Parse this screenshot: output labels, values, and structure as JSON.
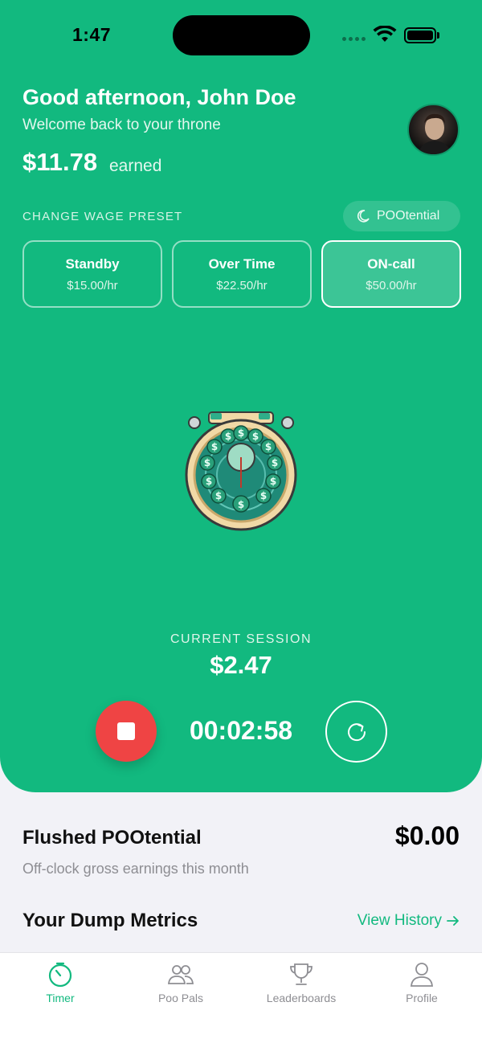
{
  "status": {
    "time": "1:47"
  },
  "header": {
    "greeting": "Good afternoon, John Doe",
    "welcome": "Welcome back to your throne",
    "earned_amount": "$11.78",
    "earned_label": "earned"
  },
  "wage": {
    "section_label": "CHANGE WAGE PRESET",
    "pootential_label": "POOtential",
    "presets": [
      {
        "name": "Standby",
        "rate": "$15.00/hr",
        "active": false
      },
      {
        "name": "Over Time",
        "rate": "$22.50/hr",
        "active": false
      },
      {
        "name": "ON-call",
        "rate": "$50.00/hr",
        "active": true
      }
    ]
  },
  "session": {
    "label": "CURRENT SESSION",
    "amount": "$2.47",
    "elapsed": "00:02:58"
  },
  "summary": {
    "flushed_title": "Flushed POOtential",
    "flushed_amount": "$0.00",
    "flushed_subtitle": "Off-clock gross earnings this month",
    "metrics_title": "Your Dump Metrics",
    "view_history": "View History"
  },
  "tabs": [
    {
      "label": "Timer",
      "icon": "timer-icon",
      "active": true
    },
    {
      "label": "Poo Pals",
      "icon": "people-icon",
      "active": false
    },
    {
      "label": "Leaderboards",
      "icon": "trophy-icon",
      "active": false
    },
    {
      "label": "Profile",
      "icon": "person-icon",
      "active": false
    }
  ],
  "colors": {
    "brand": "#12b97f",
    "stop": "#ef4444",
    "background": "#f2f2f7"
  }
}
